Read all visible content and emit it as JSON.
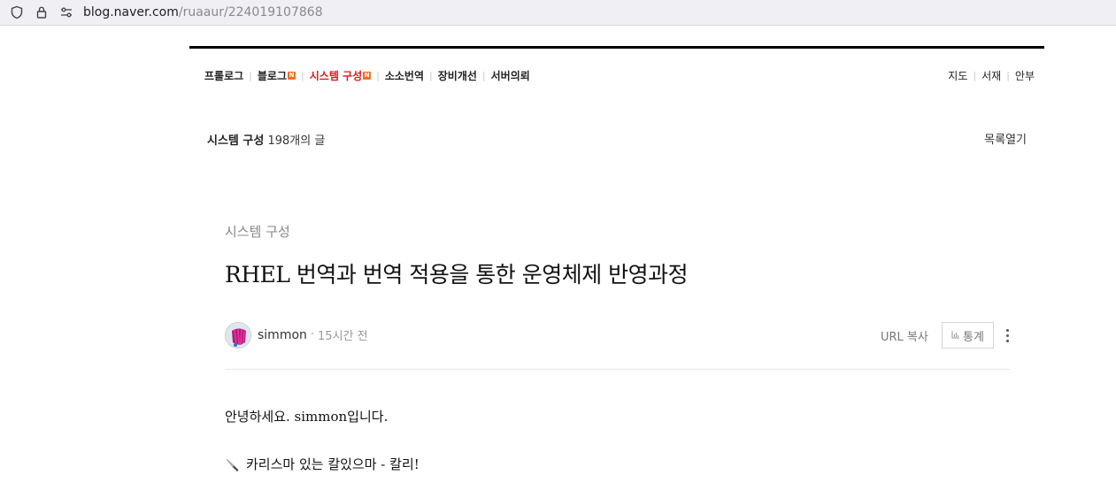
{
  "browser": {
    "url_host": "blog.naver.com",
    "url_path": "/ruaaur/224019107868"
  },
  "blog_menu": {
    "items": [
      {
        "label": "프롤로그",
        "new": false,
        "active": false
      },
      {
        "label": "블로그",
        "new": true,
        "active": false
      },
      {
        "label": "시스템 구성",
        "new": true,
        "active": true
      },
      {
        "label": "소소번역",
        "new": false,
        "active": false
      },
      {
        "label": "장비개선",
        "new": false,
        "active": false
      },
      {
        "label": "서버의뢰",
        "new": false,
        "active": false
      }
    ],
    "new_badge": "N",
    "right_items": [
      "지도",
      "서재",
      "안부"
    ]
  },
  "category_bar": {
    "name": "시스템 구성",
    "count": "198개의 글",
    "list_toggle": "목록열기"
  },
  "post": {
    "category": "시스템 구성",
    "title": "RHEL 번역과 번역 적용을 통한 운영체제 반영과정",
    "author": "simmon",
    "time_sep": "·",
    "time": "15시간 전",
    "url_copy": "URL 복사",
    "stats": "통계",
    "paragraphs": [
      "안녕하세요. simmon입니다.",
      "카리스마 있는 칼있으마 - 칼리!"
    ]
  },
  "colors": {
    "active_menu": "#e7141c",
    "new_badge": "#f37021",
    "top_line": "#000000"
  }
}
